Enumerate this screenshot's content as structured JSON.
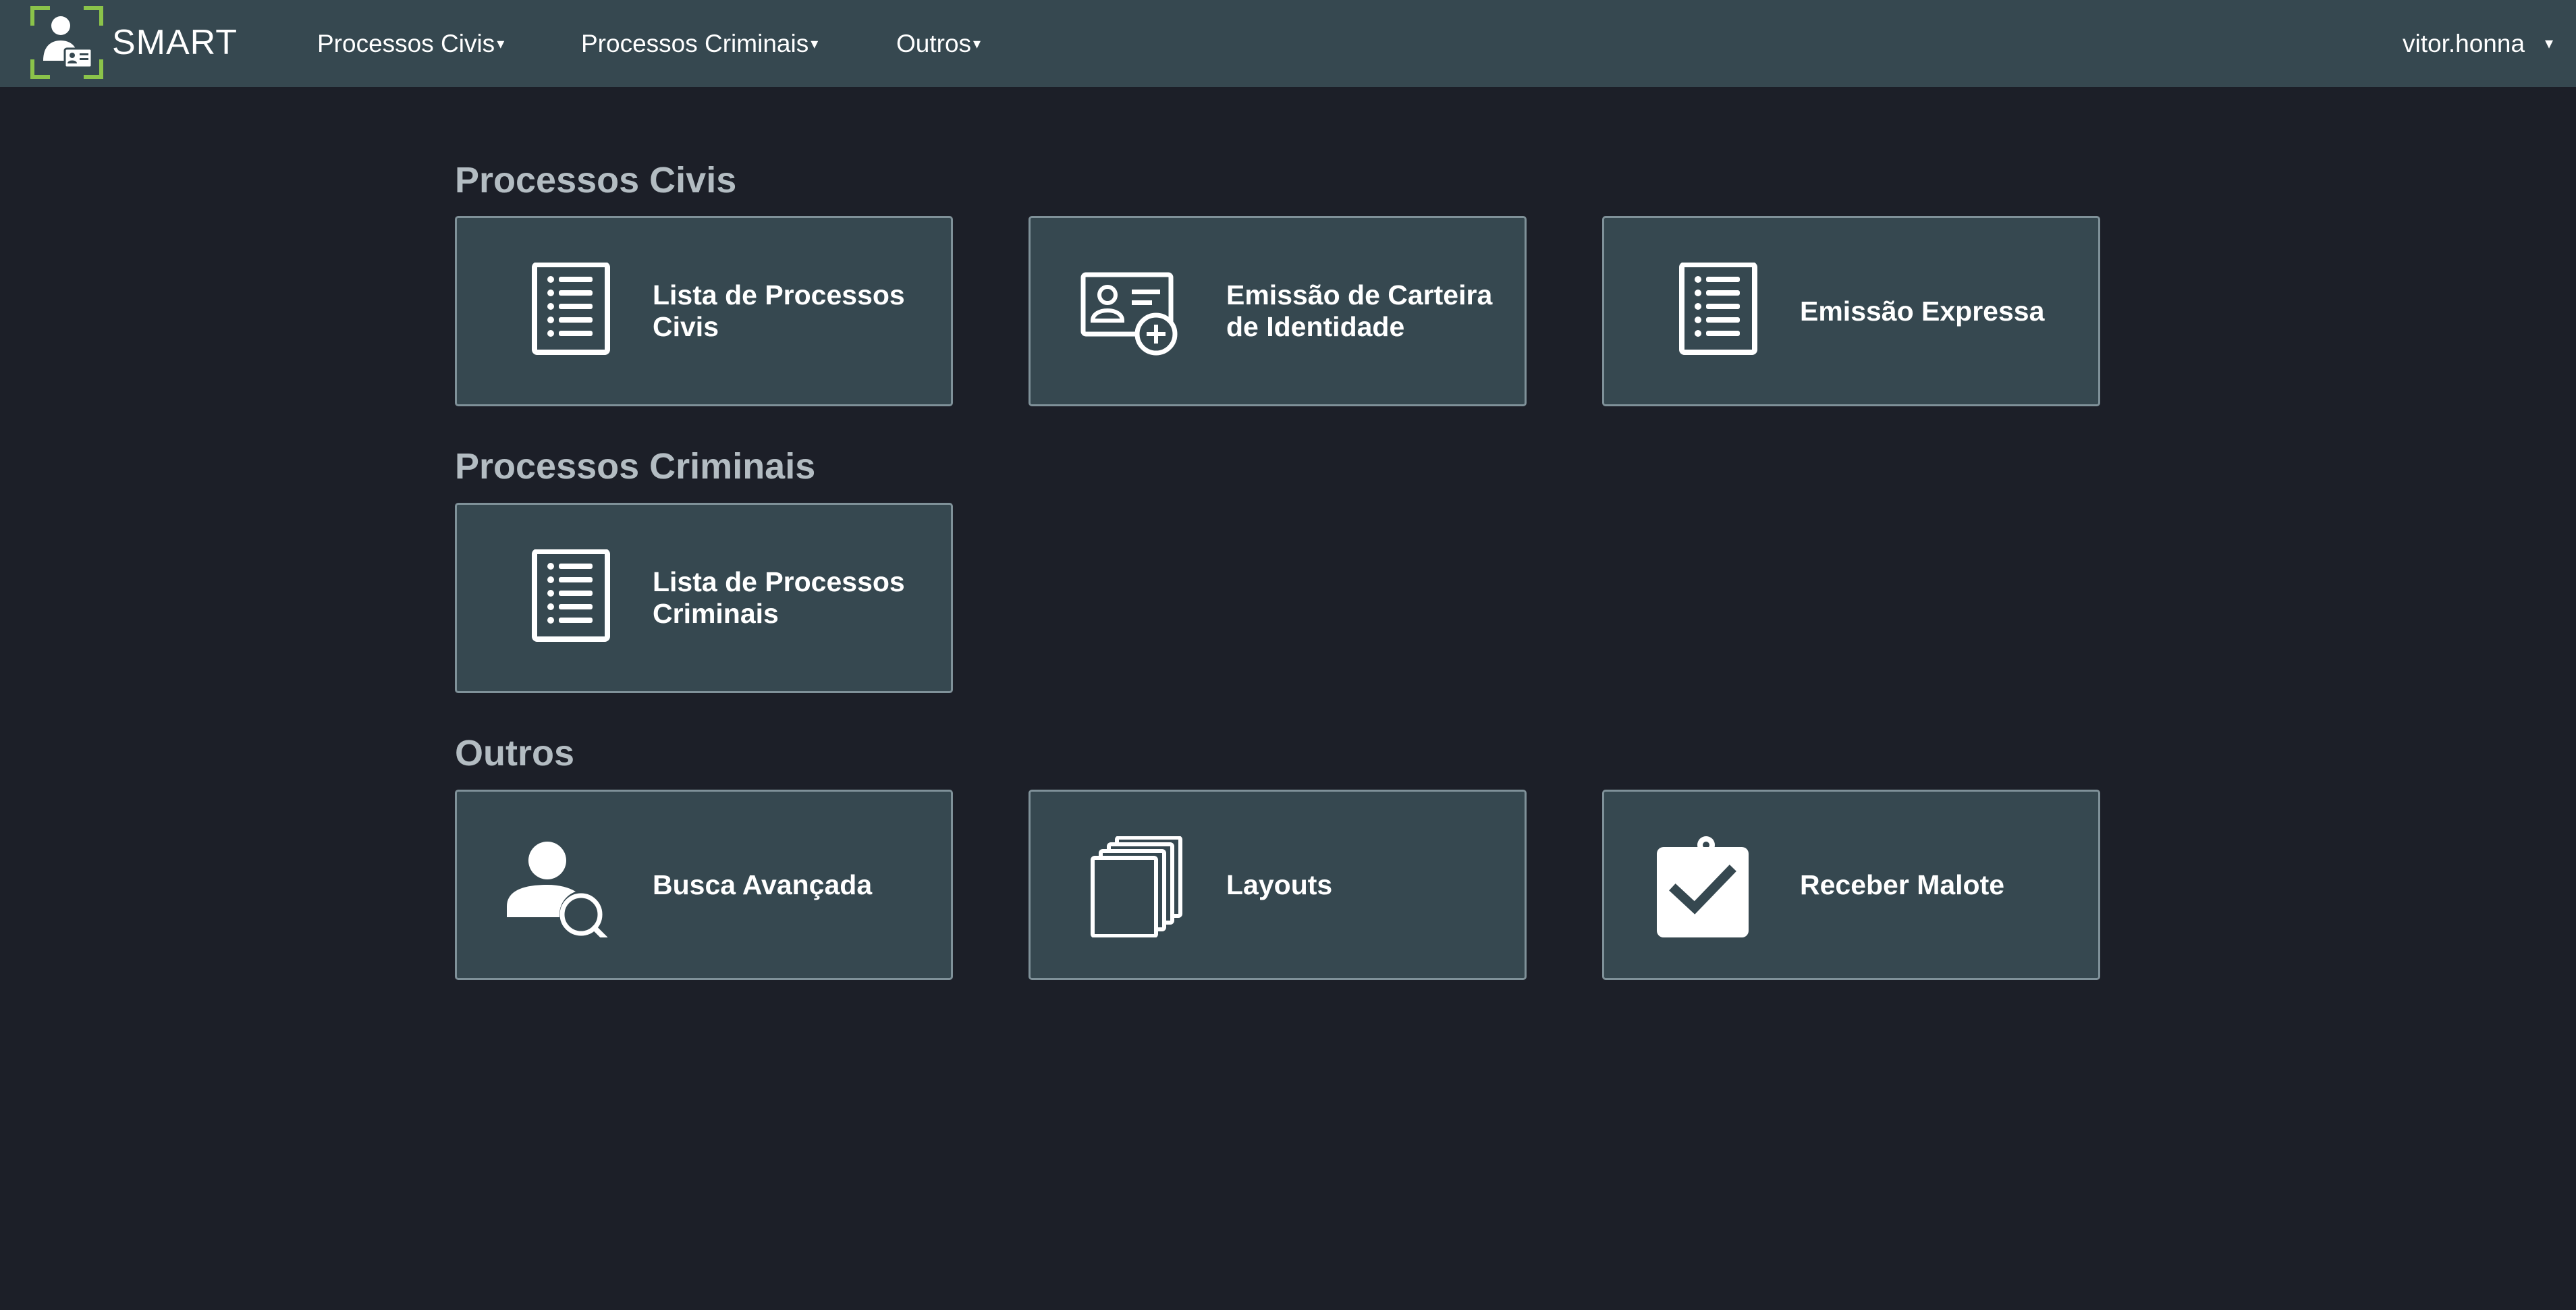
{
  "brand": {
    "name": "SMART",
    "accent_color": "#8bc34a",
    "icon": "id-card-person-logo-icon"
  },
  "nav": {
    "items": [
      {
        "label": "Processos Civis",
        "caret": "▾"
      },
      {
        "label": "Processos Criminais",
        "caret": "▾"
      },
      {
        "label": "Outros",
        "caret": "▾"
      }
    ],
    "user": {
      "label": "vitor.honna",
      "caret": "▾"
    }
  },
  "sections": [
    {
      "title": "Processos Civis",
      "tiles": [
        {
          "label": "Lista de Processos Civis",
          "icon": "list-document-icon"
        },
        {
          "label": "Emissão de Carteira de Identidade",
          "icon": "id-card-add-icon"
        },
        {
          "label": "Emissão Expressa",
          "icon": "list-document-icon"
        }
      ]
    },
    {
      "title": "Processos Criminais",
      "tiles": [
        {
          "label": "Lista de Processos Criminais",
          "icon": "list-document-icon"
        }
      ]
    },
    {
      "title": "Outros",
      "tiles": [
        {
          "label": "Busca Avançada",
          "icon": "user-search-icon"
        },
        {
          "label": "Layouts",
          "icon": "stacked-pages-icon"
        },
        {
          "label": "Receber Malote",
          "icon": "clipboard-check-icon"
        }
      ]
    }
  ],
  "colors": {
    "background": "#1c1f28",
    "navbar": "#364850",
    "tile": "#364850",
    "tile_border": "#7f9199",
    "section_title": "#b3bcc2"
  }
}
